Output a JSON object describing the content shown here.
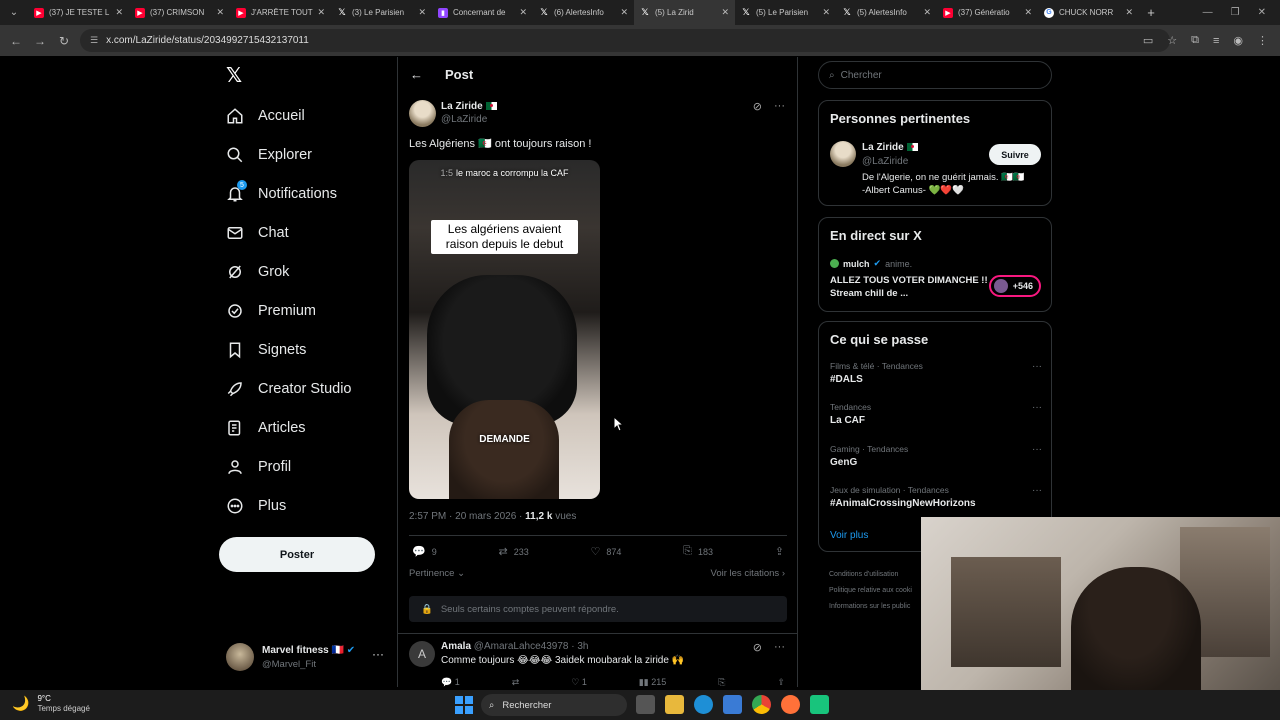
{
  "browser": {
    "tabs": [
      {
        "label": "(37) JE TESTE L",
        "icon": "youtube-icon"
      },
      {
        "label": "(37) CRIMSON",
        "icon": "youtube-icon"
      },
      {
        "label": "J'ARRÊTE TOUT",
        "icon": "youtube-icon"
      },
      {
        "label": "(3) Le Parisien",
        "icon": "x-icon"
      },
      {
        "label": "Concernant de",
        "icon": "twitch-icon"
      },
      {
        "label": "(6) AlertesInfo",
        "icon": "x-icon"
      },
      {
        "label": "(5) La Zirid",
        "icon": "x-icon"
      },
      {
        "label": "(5) Le Parisien",
        "icon": "x-icon"
      },
      {
        "label": "(5) AlertesInfo",
        "icon": "x-icon"
      },
      {
        "label": "(37) Génératio",
        "icon": "youtube-icon"
      },
      {
        "label": "CHUCK NORR",
        "icon": "google-icon"
      }
    ],
    "active_tab_index": 6,
    "url": "x.com/LaZiride/status/2034992715432137011"
  },
  "nav": {
    "items": [
      {
        "label": "Accueil",
        "icon": "home-icon"
      },
      {
        "label": "Explorer",
        "icon": "search-icon"
      },
      {
        "label": "Notifications",
        "icon": "bell-icon",
        "badge": "5"
      },
      {
        "label": "Chat",
        "icon": "mail-icon"
      },
      {
        "label": "Grok",
        "icon": "grok-icon"
      },
      {
        "label": "Premium",
        "icon": "verified-icon"
      },
      {
        "label": "Signets",
        "icon": "bookmark-icon"
      },
      {
        "label": "Creator Studio",
        "icon": "rocket-icon"
      },
      {
        "label": "Articles",
        "icon": "article-icon"
      },
      {
        "label": "Profil",
        "icon": "person-icon"
      },
      {
        "label": "Plus",
        "icon": "more-circle-icon"
      }
    ],
    "post_button": "Poster",
    "account": {
      "name": "Marvel fitness",
      "handle": "@Marvel_Fit"
    }
  },
  "post": {
    "header": "Post",
    "author_name": "La Ziride",
    "author_handle": "@LaZiride",
    "text": "Les Algériens 🇩🇿 ont toujours raison !",
    "video": {
      "timer": "1:5",
      "overlay_top": "le maroc a corrompu la CAF",
      "caption": "Les algériens avaient raison depuis le debut",
      "word": "DEMANDE"
    },
    "time": "2:57 PM · 20 mars 2026 · ",
    "views_count": "11,2 k",
    "views_label": " vues",
    "stats": {
      "replies": "9",
      "reposts": "233",
      "likes": "874",
      "bookmarks": "183"
    },
    "relevance": "Pertinence",
    "see_quotes": "Voir les citations",
    "reply_restriction": "Seuls certains comptes peuvent répondre."
  },
  "reply": {
    "avatar_letter": "A",
    "name": "Amala",
    "handle": "@AmaraLahce43978",
    "time": "3h",
    "text": "Comme toujours 😂😂😂 3aidek moubarak la ziride 🙌",
    "stats": {
      "replies": "1",
      "likes": "1",
      "views": "215"
    }
  },
  "sidebar": {
    "search_placeholder": "Chercher",
    "relevant_people": {
      "title": "Personnes pertinentes",
      "name": "La Ziride",
      "handle": "@LaZiride",
      "follow": "Suivre",
      "bio_line1": "De l'Algerie, on ne guérit jamais. 🇩🇿🇩🇿",
      "bio_line2": "-Albert Camus- 💚❤️🤍"
    },
    "live": {
      "title": "En direct sur X",
      "host": "mulch",
      "sub": "anime.",
      "stream_title": "ALLEZ TOUS VOTER DIMANCHE !! Stream chill de ...",
      "count": "+546"
    },
    "trends": {
      "title": "Ce qui se passe",
      "items": [
        {
          "category": "Films & télé · Tendances",
          "title": "#DALS"
        },
        {
          "category": "Tendances",
          "title": "La CAF"
        },
        {
          "category": "Gaming · Tendances",
          "title": "GenG"
        },
        {
          "category": "Jeux de simulation · Tendances",
          "title": "#AnimalCrossingNewHorizons"
        }
      ],
      "see_more": "Voir plus"
    },
    "footer": [
      "Conditions d'utilisation",
      "Politique relative aux cooki",
      "Informations sur les public"
    ]
  },
  "taskbar": {
    "temperature": "9°C",
    "weather": "Temps dégagé",
    "search": "Rechercher"
  },
  "colors": {
    "accent": "#1d9bf0",
    "background": "#000000",
    "muted": "#71767b",
    "live": "#f91880"
  }
}
